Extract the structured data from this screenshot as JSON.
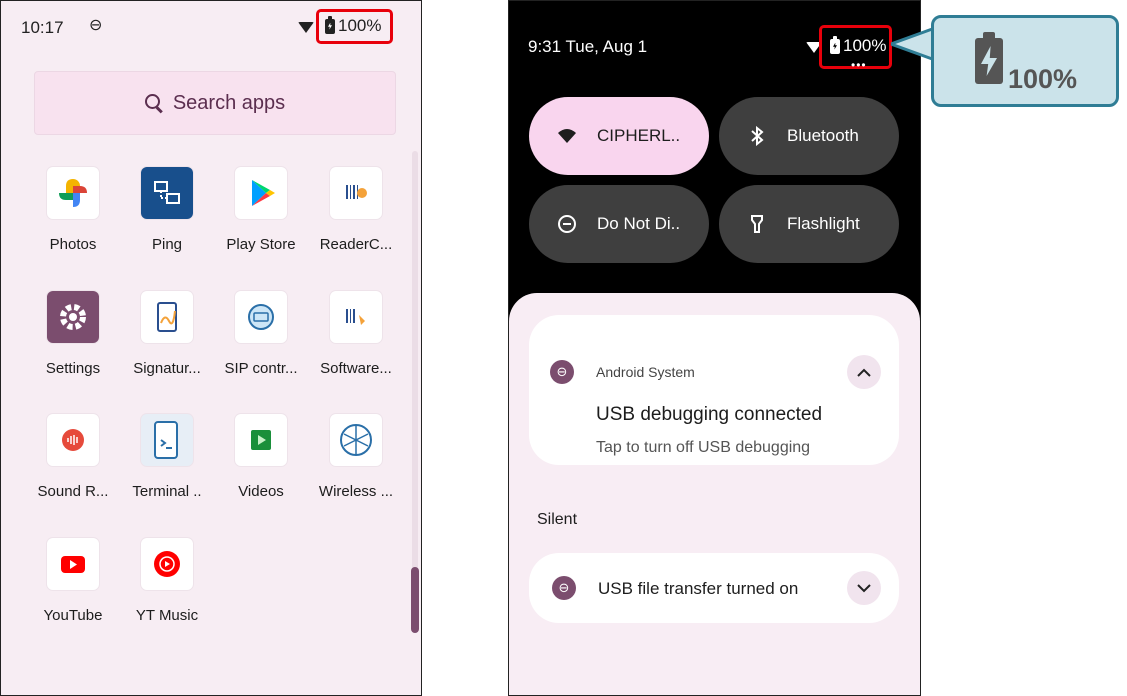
{
  "left_screen": {
    "status_bar": {
      "time": "10:17",
      "sim_glyph": "⊖",
      "battery": "100%"
    },
    "search": {
      "label": "Search apps"
    },
    "apps": [
      {
        "label": "Photos"
      },
      {
        "label": "Ping"
      },
      {
        "label": "Play Store"
      },
      {
        "label": "ReaderC..."
      },
      {
        "label": "Settings"
      },
      {
        "label": "Signatur..."
      },
      {
        "label": "SIP contr..."
      },
      {
        "label": "Software..."
      },
      {
        "label": "Sound R..."
      },
      {
        "label": "Terminal .."
      },
      {
        "label": "Videos"
      },
      {
        "label": "Wireless ..."
      },
      {
        "label": "YouTube"
      },
      {
        "label": "YT Music"
      }
    ]
  },
  "right_screen": {
    "status_bar": {
      "datetime": "9:31 Tue, Aug 1",
      "battery": "100%"
    },
    "quick_tiles": [
      {
        "label": "CIPHERL..",
        "icon": "wifi-icon",
        "active": true
      },
      {
        "label": "Bluetooth",
        "icon": "bluetooth-icon",
        "active": false
      },
      {
        "label": "Do Not Di..",
        "icon": "do-not-disturb-icon",
        "active": false
      },
      {
        "label": "Flashlight",
        "icon": "flashlight-icon",
        "active": false
      }
    ],
    "notification_1": {
      "source": "Android System",
      "title": "USB debugging connected",
      "body": "Tap to turn off USB debugging"
    },
    "silent_section": {
      "label": "Silent"
    },
    "notification_2": {
      "title": "USB file transfer turned on"
    }
  },
  "callout": {
    "battery": "100%"
  },
  "colors": {
    "highlight": "#e8000b",
    "callout_fill": "#cbe3ea",
    "callout_border": "#2f7d95",
    "accent": "#7b4d6e"
  }
}
